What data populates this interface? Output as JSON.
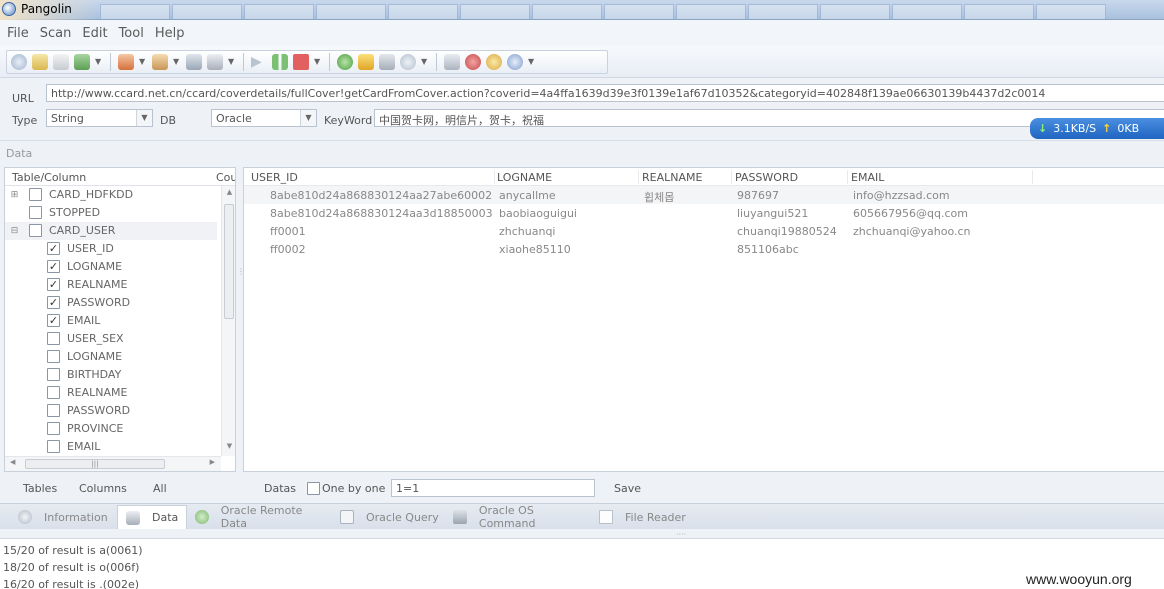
{
  "window": {
    "title": "Pangolin"
  },
  "menu": [
    "File",
    "Scan",
    "Edit",
    "Tool",
    "Help"
  ],
  "toolbar": {
    "icons": [
      "open-icon",
      "document-icon",
      "export-icon",
      "import-icon",
      "settings-icon",
      "plugin-icon",
      "wrench-icon",
      "database-icon",
      "play-icon",
      "pause-icon",
      "stop-icon",
      "help-icon",
      "key-icon",
      "inject-icon",
      "search-icon",
      "home-icon",
      "bug-icon",
      "tools-icon",
      "info-icon"
    ]
  },
  "form": {
    "url_label": "URL",
    "url_value": "http://www.ccard.net.cn/ccard/coverdetails/fullCover!getCardFromCover.action?coverid=4a4ffa1639d39e3f0139e1af67d10352&categoryid=402848f139ae06630139b4437d2c0014",
    "type_label": "Type",
    "type_value": "String",
    "db_label": "DB",
    "db_value": "Oracle",
    "keyword_label": "KeyWord",
    "keyword_value": "中国贺卡网，明信片，贺卡，祝福"
  },
  "speed": {
    "down": "3.1KB/S",
    "up": "0KB"
  },
  "data_section_label": "Data",
  "tree": {
    "header_col1": "Table/Column",
    "header_col2": "Cou",
    "rows": [
      {
        "label": "CARD_HDFKDD",
        "checked": false,
        "level": 0,
        "expander": "+"
      },
      {
        "label": "STOPPED",
        "checked": false,
        "level": 0,
        "expander": ""
      },
      {
        "label": "CARD_USER",
        "checked": false,
        "level": 0,
        "expander": "−"
      },
      {
        "label": "USER_ID",
        "checked": true,
        "level": 1,
        "expander": ""
      },
      {
        "label": "LOGNAME",
        "checked": true,
        "level": 1,
        "expander": ""
      },
      {
        "label": "REALNAME",
        "checked": true,
        "level": 1,
        "expander": ""
      },
      {
        "label": "PASSWORD",
        "checked": true,
        "level": 1,
        "expander": ""
      },
      {
        "label": "EMAIL",
        "checked": true,
        "level": 1,
        "expander": ""
      },
      {
        "label": "USER_SEX",
        "checked": false,
        "level": 1,
        "expander": ""
      },
      {
        "label": "LOGNAME",
        "checked": false,
        "level": 1,
        "expander": ""
      },
      {
        "label": "BIRTHDAY",
        "checked": false,
        "level": 1,
        "expander": ""
      },
      {
        "label": "REALNAME",
        "checked": false,
        "level": 1,
        "expander": ""
      },
      {
        "label": "PASSWORD",
        "checked": false,
        "level": 1,
        "expander": ""
      },
      {
        "label": "PROVINCE",
        "checked": false,
        "level": 1,
        "expander": ""
      },
      {
        "label": "EMAIL",
        "checked": false,
        "level": 1,
        "expander": ""
      }
    ]
  },
  "grid": {
    "columns": [
      "USER_ID",
      "LOGNAME",
      "REALNAME",
      "PASSWORD",
      "EMAIL"
    ],
    "rows": [
      [
        "8abe810d24a868830124aa27abe60002",
        "anycallme",
        "휩체몹",
        "987697",
        "info@hzzsad.com"
      ],
      [
        "8abe810d24a868830124aa3d18850003",
        "baobiaoguigui",
        "",
        "liuyangui521",
        "605667956@qq.com"
      ],
      [
        "ff0001",
        "zhchuanqi",
        "",
        "chuanqi19880524",
        "zhchuanqi@yahoo.cn"
      ],
      [
        "ff0002",
        "xiaohe85110",
        "",
        "851106abc",
        ""
      ]
    ]
  },
  "left_footer": {
    "tables": "Tables",
    "columns": "Columns",
    "all": "All"
  },
  "right_footer": {
    "datas": "Datas",
    "one_by_one": "One by one",
    "condition": "1=1",
    "save": "Save"
  },
  "tabs": [
    {
      "label": "Information",
      "active": false
    },
    {
      "label": "Data",
      "active": true
    },
    {
      "label": "Oracle Remote Data",
      "active": false
    },
    {
      "label": "Oracle Query",
      "active": false
    },
    {
      "label": "Oracle OS Command",
      "active": false
    },
    {
      "label": "File Reader",
      "active": false
    }
  ],
  "log": [
    "15/20 of result is a(0061)",
    "18/20 of result is o(006f)",
    "16/20 of result is .(002e)"
  ],
  "watermark": "www.wooyun.org",
  "colors": {
    "accent": "#2a70cc",
    "border": "#c8d0da",
    "background": "#eef2f7"
  }
}
